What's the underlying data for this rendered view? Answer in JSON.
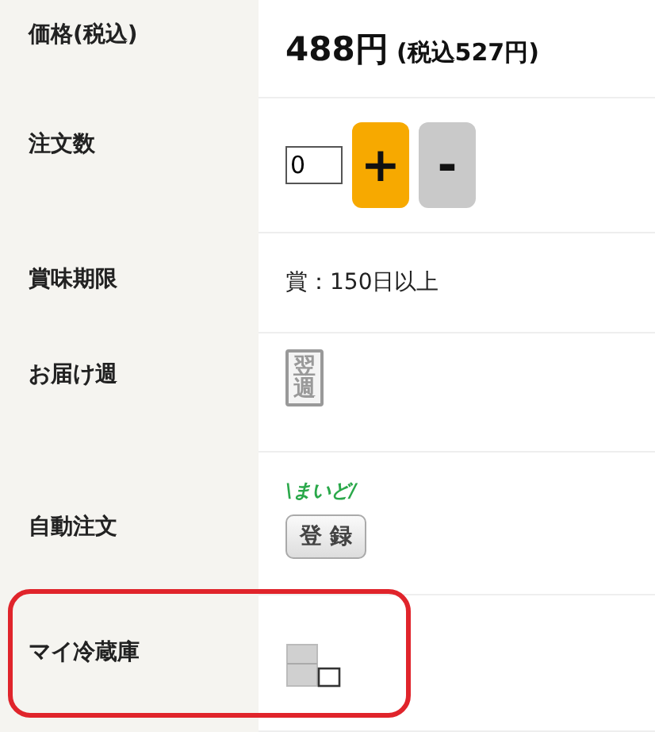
{
  "rows": [
    {
      "kind": "price",
      "label": "価格(税込)",
      "price": "488円",
      "tax_included": "(税込527円)"
    },
    {
      "kind": "quantity",
      "label": "注文数",
      "value": "0",
      "plus": "+",
      "minus": "-"
    },
    {
      "kind": "text",
      "label": "賞味期限",
      "text": "賞：150日以上"
    },
    {
      "kind": "week_badge",
      "label": "お届け週",
      "badge": "翌週"
    },
    {
      "kind": "register",
      "label": "自動注文",
      "caption": "\\まいど/",
      "button": "登 録"
    },
    {
      "kind": "fridge",
      "label": "マイ冷蔵庫",
      "highlighted": true
    }
  ]
}
